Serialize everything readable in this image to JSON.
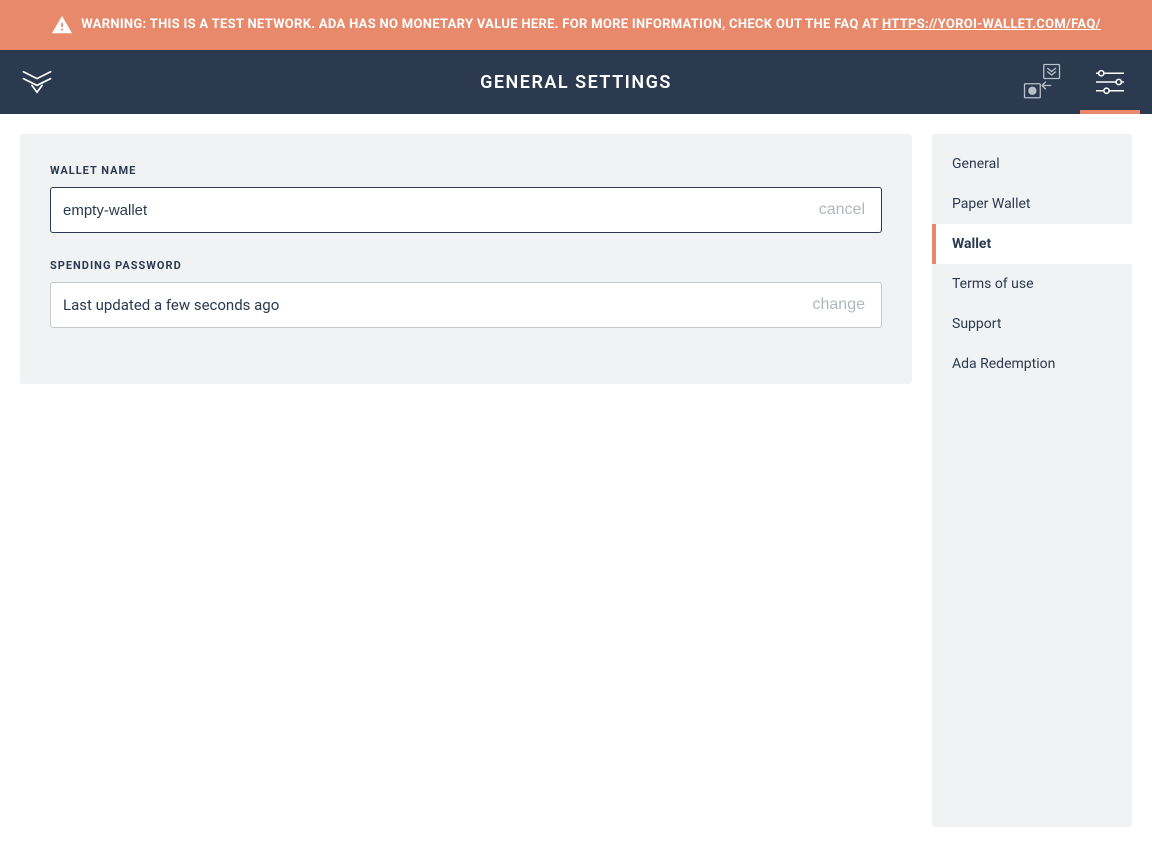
{
  "warning": {
    "text_prefix": "WARNING: THIS IS A TEST NETWORK. ADA HAS NO MONETARY VALUE HERE. FOR MORE INFORMATION, CHECK OUT THE FAQ AT ",
    "link_text": "HTTPS://YOROI-WALLET.COM/FAQ/"
  },
  "header": {
    "title": "GENERAL SETTINGS"
  },
  "wallet_name": {
    "label": "WALLET NAME",
    "value": "empty-wallet",
    "action": "cancel"
  },
  "spending_password": {
    "label": "SPENDING PASSWORD",
    "status": "Last updated a few seconds ago",
    "action": "change"
  },
  "sidebar": {
    "items": [
      {
        "label": "General",
        "active": false
      },
      {
        "label": "Paper Wallet",
        "active": false
      },
      {
        "label": "Wallet",
        "active": true
      },
      {
        "label": "Terms of use",
        "active": false
      },
      {
        "label": "Support",
        "active": false
      },
      {
        "label": "Ada Redemption",
        "active": false
      }
    ]
  },
  "colors": {
    "accent": "#e8896c",
    "header_bg": "#2b3a4e",
    "panel_bg": "#f1f2f4"
  }
}
